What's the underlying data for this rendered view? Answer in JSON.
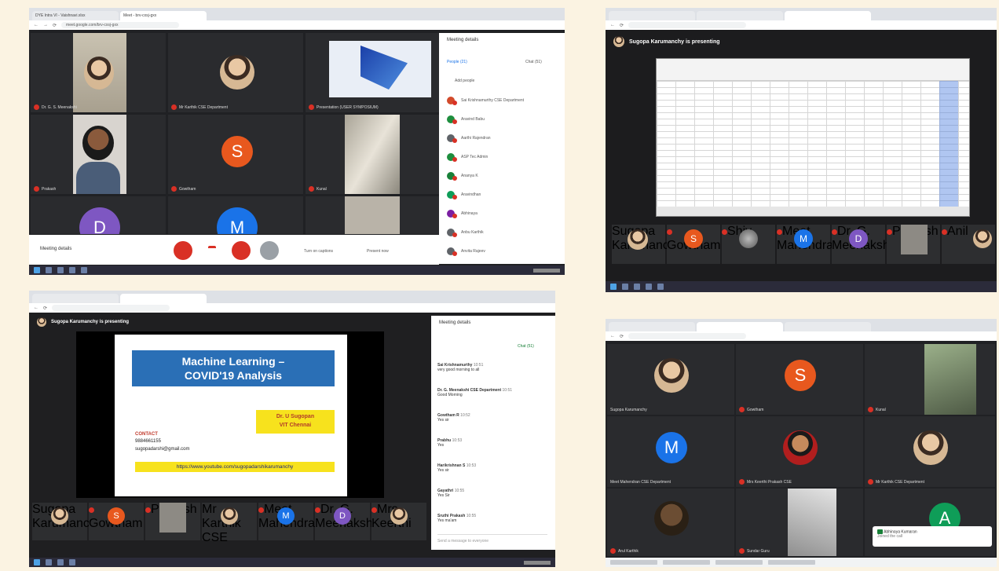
{
  "shot1": {
    "tabs": [
      "DYE Intra VI - Vaishnavi.xlsx",
      "Meet - brv-cxsj-gxx"
    ],
    "url": "meet.google.com/brv-cxsj-gxx",
    "panel_title": "Meeting details",
    "people_tab": "People (21)",
    "chat_tab": "Chat (51)",
    "add_people": "Add people",
    "participants": [
      {
        "name": "Sai Krishnamurthy CSE Department",
        "color": "#d24a2b"
      },
      {
        "name": "Aravind Babu",
        "color": "#1e8e3e"
      },
      {
        "name": "Aarthi Rajendran",
        "color": "#5f6368"
      },
      {
        "name": "ASP Tec Admin",
        "color": "#1e8e3e"
      },
      {
        "name": "Ananya K",
        "color": "#188038"
      },
      {
        "name": "Aravindhan",
        "color": "#0f9d58"
      },
      {
        "name": "Abhinaya",
        "color": "#7b1fa2"
      },
      {
        "name": "Anbu Karthik",
        "color": "#5f6368"
      },
      {
        "name": "Anvita Rajeev",
        "color": "#5f6368"
      }
    ],
    "tiles": [
      {
        "name": "Dr. G. S. Meenakshi",
        "kind": "video"
      },
      {
        "name": "Mr Karthik CSE Department",
        "kind": "photo"
      },
      {
        "name": "Presentation (USER SYMPOSIUM)",
        "kind": "screen"
      },
      {
        "name": "Prakash",
        "kind": "video"
      },
      {
        "name": "Gowtham",
        "letter": "S",
        "color": "#e8581e"
      },
      {
        "name": "Kunal",
        "kind": "video"
      },
      {
        "name": "",
        "letter": "D",
        "color": "#7e57c2"
      },
      {
        "name": "",
        "letter": "M",
        "color": "#1a73e8"
      }
    ],
    "meeting_details": "Meeting details",
    "turn_on_captions": "Turn on captions",
    "present_now": "Present now"
  },
  "shot2": {
    "presenting": "Sugopa Karumanchy is presenting",
    "filmstrip": [
      {
        "name": "Sugopa Karumanchy",
        "kind": "photo"
      },
      {
        "name": "Gowtham",
        "letter": "S",
        "color": "#e8581e"
      },
      {
        "name": "Shiv",
        "kind": "photo"
      },
      {
        "name": "Meet Mahendra",
        "letter": "M",
        "color": "#1a73e8"
      },
      {
        "name": "Dr. G. Meenakshi",
        "letter": "D",
        "color": "#7e57c2"
      },
      {
        "name": "Prakash",
        "kind": "video"
      },
      {
        "name": "Anil",
        "kind": "photo"
      }
    ]
  },
  "shot3": {
    "presenting": "Sugopa Karumanchy is presenting",
    "slide_title": "Machine Learning –\nCOVID'19 Analysis",
    "slide_author": "Dr. U Sugopan\nVIT Chennai",
    "slide_contact_label": "CONTACT",
    "slide_phone": "9884661155",
    "slide_email": "sugopadarshi@gmail.com",
    "slide_link": "https://www.youtube.com/sugopadarshikarumanchy",
    "panel_title": "Meeting details",
    "chat_tab": "Chat (51)",
    "chat": [
      {
        "who": "Sai Krishnamurthy",
        "time": "10:51",
        "text": "very good morning to all"
      },
      {
        "who": "Dr. G. Meenakshi CSE Department",
        "time": "10:51",
        "text": "Good Morning"
      },
      {
        "who": "Gowtham R",
        "time": "10:52",
        "text": "Yes sir"
      },
      {
        "who": "Prabhu",
        "time": "10:53",
        "text": "Yes"
      },
      {
        "who": "Harikrishnan S",
        "time": "10:53",
        "text": "Yes sir"
      },
      {
        "who": "Gayathri",
        "time": "10:55",
        "text": "Yes Sir"
      },
      {
        "who": "Sruthi Prakash",
        "time": "10:55",
        "text": "Yes ma'am"
      }
    ],
    "send_placeholder": "Send a message to everyone",
    "filmstrip": [
      {
        "name": "Sugopa Karumanchy",
        "kind": "photo"
      },
      {
        "name": "Gowtham",
        "letter": "S",
        "color": "#e8581e"
      },
      {
        "name": "Prakash",
        "kind": "video"
      },
      {
        "name": "Mr Karthik CSE",
        "kind": "photo"
      },
      {
        "name": "Meet Mahendra",
        "letter": "M",
        "color": "#1a73e8"
      },
      {
        "name": "Dr. G. Meenakshi",
        "letter": "D",
        "color": "#7e57c2"
      },
      {
        "name": "Mrs Keerthi",
        "kind": "photo"
      }
    ]
  },
  "shot4": {
    "tiles": [
      {
        "name": "Sugopa Karumanchy",
        "kind": "photo"
      },
      {
        "name": "Gowtham",
        "letter": "S",
        "color": "#e8581e"
      },
      {
        "name": "Kunal",
        "kind": "video"
      },
      {
        "name": "Meet Mahendran CSE Department",
        "letter": "M",
        "color": "#1a73e8"
      },
      {
        "name": "Mrs Keerthi Prakash CSE",
        "kind": "photo"
      },
      {
        "name": "Mr Karthik CSE Department",
        "kind": "photo"
      },
      {
        "name": "Arul Karthik",
        "kind": "photo"
      },
      {
        "name": "Sundar Guru",
        "kind": "video"
      },
      {
        "name": "",
        "letter": "A",
        "color": "#0f9d58"
      }
    ],
    "toast_title": "Abhinaya Kumaran",
    "toast_text": "Joined the call"
  }
}
